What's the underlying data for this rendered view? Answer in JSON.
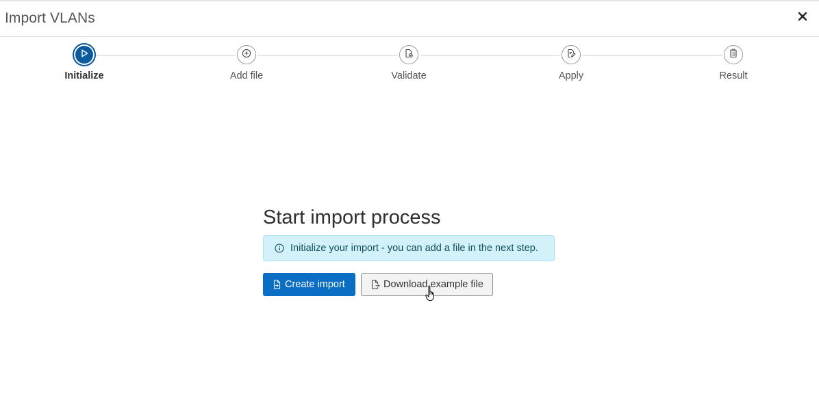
{
  "modal": {
    "title": "Import VLANs",
    "close_icon": "close-icon"
  },
  "stepper": {
    "active_index": 0,
    "steps": [
      {
        "label": "Initialize",
        "icon": "play-icon"
      },
      {
        "label": "Add file",
        "icon": "plus-circle-icon"
      },
      {
        "label": "Validate",
        "icon": "file-check-icon"
      },
      {
        "label": "Apply",
        "icon": "file-edit-icon"
      },
      {
        "label": "Result",
        "icon": "clipboard-list-icon"
      }
    ]
  },
  "main": {
    "title": "Start import process",
    "info_text": "Initialize your import - you can add a file in the next step.",
    "info_icon": "info-icon",
    "create_button": "Create import",
    "create_icon": "file-import-icon",
    "download_button": "Download example file",
    "download_icon": "file-export-icon"
  },
  "colors": {
    "primary": "#0a6fc4",
    "active_step": "#0a5a9c",
    "info_background": "#d3f1f8",
    "info_text": "#0e4f5d"
  }
}
